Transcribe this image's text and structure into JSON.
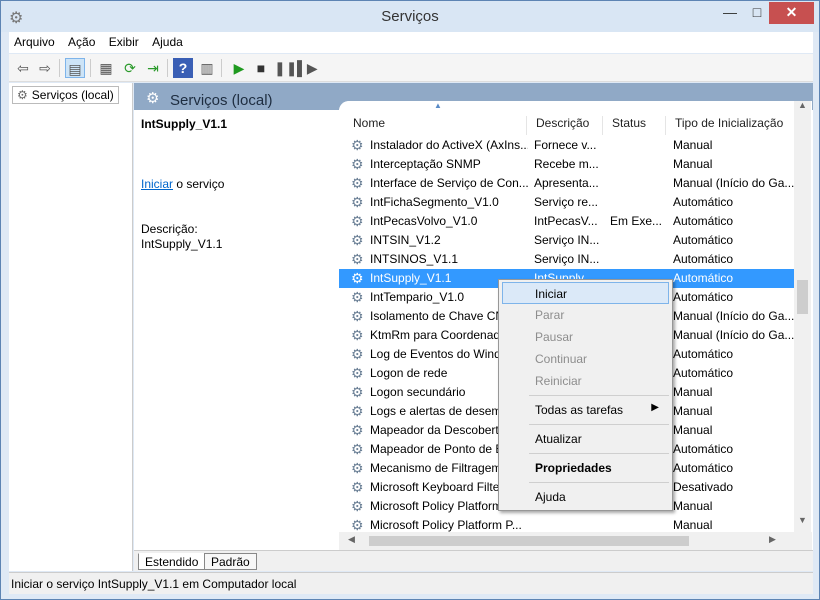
{
  "window": {
    "title": "Serviços"
  },
  "menu": [
    "Arquivo",
    "Ação",
    "Exibir",
    "Ajuda"
  ],
  "tree": {
    "item": "Serviços (local)"
  },
  "right_header": {
    "title": "Serviços (local)"
  },
  "description_pane": {
    "name": "IntSupply_V1.1",
    "start_link": "Iniciar",
    "start_suffix": " o serviço",
    "description_label": "Descrição:",
    "description_value": "IntSupply_V1.1"
  },
  "columns": [
    "Nome",
    "Descrição",
    "Status",
    "Tipo de Inicialização"
  ],
  "rows": [
    {
      "name": "Instalador do ActiveX (AxIns...",
      "desc": "Fornece v...",
      "status": "",
      "startup": "Manual"
    },
    {
      "name": "Interceptação SNMP",
      "desc": "Recebe m...",
      "status": "",
      "startup": "Manual"
    },
    {
      "name": "Interface de Serviço de Con...",
      "desc": "Apresenta...",
      "status": "",
      "startup": "Manual (Início do Ga..."
    },
    {
      "name": "IntFichaSegmento_V1.0",
      "desc": "Serviço re...",
      "status": "",
      "startup": "Automático"
    },
    {
      "name": "IntPecasVolvo_V1.0",
      "desc": "IntPecasV...",
      "status": "Em Exe...",
      "startup": "Automático"
    },
    {
      "name": "INTSIN_V1.2",
      "desc": "Serviço IN...",
      "status": "",
      "startup": "Automático"
    },
    {
      "name": "INTSINOS_V1.1",
      "desc": "Serviço IN...",
      "status": "",
      "startup": "Automático"
    },
    {
      "name": "IntSupply_V1.1",
      "desc": "IntSupply...",
      "status": "",
      "startup": "Automático"
    },
    {
      "name": "IntTempario_V1.0",
      "desc": "",
      "status": "",
      "startup": "Automático"
    },
    {
      "name": "Isolamento de Chave CNG",
      "desc": "",
      "status": "",
      "startup": "Manual (Início do Ga..."
    },
    {
      "name": "KtmRm para Coordenador",
      "desc": "",
      "status": "",
      "startup": "Manual (Início do Ga..."
    },
    {
      "name": "Log de Eventos do Windows",
      "desc": "",
      "status": "",
      "startup": "Automático"
    },
    {
      "name": "Logon de rede",
      "desc": "",
      "status": "",
      "startup": "Automático"
    },
    {
      "name": "Logon secundário",
      "desc": "",
      "status": "",
      "startup": "Manual"
    },
    {
      "name": "Logs e alertas de desempenho",
      "desc": "",
      "status": "",
      "startup": "Manual"
    },
    {
      "name": "Mapeador da Descoberta",
      "desc": "",
      "status": "",
      "startup": "Manual"
    },
    {
      "name": "Mapeador de Ponto de Extremidade",
      "desc": "",
      "status": "",
      "startup": "Automático"
    },
    {
      "name": "Mecanismo de Filtragem",
      "desc": "",
      "status": "",
      "startup": "Automático"
    },
    {
      "name": "Microsoft Keyboard Filter",
      "desc": "",
      "status": "",
      "startup": "Desativado"
    },
    {
      "name": "Microsoft Policy Platform",
      "desc": "",
      "status": "",
      "startup": "Manual"
    },
    {
      "name": "Microsoft Policy Platform P...",
      "desc": "",
      "status": "",
      "startup": "Manual"
    }
  ],
  "selected_row": 7,
  "context_menu": {
    "iniciar": "Iniciar",
    "parar": "Parar",
    "pausar": "Pausar",
    "continuar": "Continuar",
    "reiniciar": "Reiniciar",
    "todas": "Todas as tarefas",
    "atualizar": "Atualizar",
    "propriedades": "Propriedades",
    "ajuda": "Ajuda"
  },
  "tabs": [
    "Estendido",
    "Padrão"
  ],
  "status_bar": "Iniciar o serviço IntSupply_V1.1 em Computador local",
  "colors": {
    "selection": "#3399ff",
    "header": "#90a9c6",
    "close": "#c75050"
  }
}
